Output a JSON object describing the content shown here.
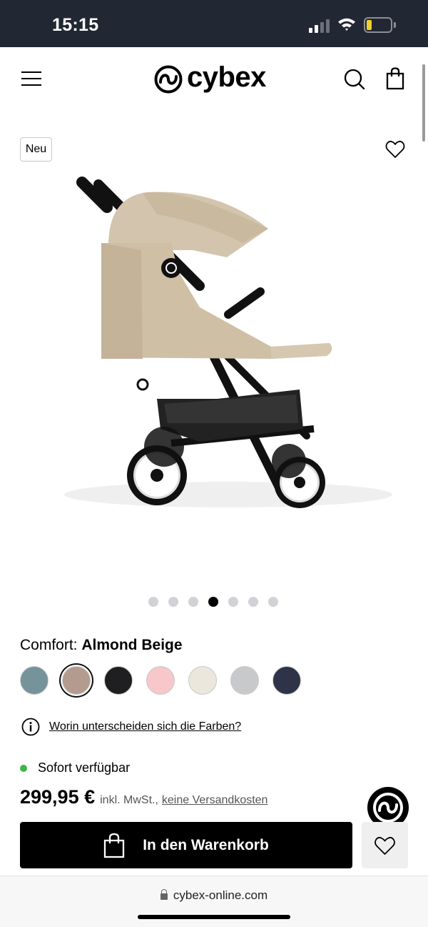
{
  "status_bar": {
    "time": "15:15"
  },
  "header": {
    "logo_text": "cybex",
    "icons": [
      "menu-icon",
      "search-icon",
      "shopping-bag-icon"
    ]
  },
  "product": {
    "badge": "Neu",
    "gallery": {
      "image_count": 7,
      "active_index": 4
    },
    "variant": {
      "label": "Comfort:",
      "value": "Almond Beige"
    },
    "swatches": [
      {
        "name": "blue-grey",
        "color": "#76929b"
      },
      {
        "name": "almond-beige",
        "color": "#b49b8f",
        "selected": true
      },
      {
        "name": "black",
        "color": "#1f1f22"
      },
      {
        "name": "pink",
        "color": "#f7c7c9"
      },
      {
        "name": "cream",
        "color": "#ebe7dc"
      },
      {
        "name": "light-grey",
        "color": "#c8c9cb"
      },
      {
        "name": "navy",
        "color": "#2f3347"
      }
    ],
    "color_info_link": "Worin unterscheiden sich die Farben?",
    "availability": "Sofort verfügbar",
    "price": "299,95 €",
    "vat_text": "inkl. MwSt.,",
    "shipping_text": "keine Versandkosten",
    "add_to_cart_label": "In den Warenkorb"
  },
  "browser": {
    "url": "cybex-online.com"
  },
  "colors": {
    "status_bar_bg": "#222833",
    "availability_green": "#3cb54a",
    "button_black": "#000000"
  }
}
